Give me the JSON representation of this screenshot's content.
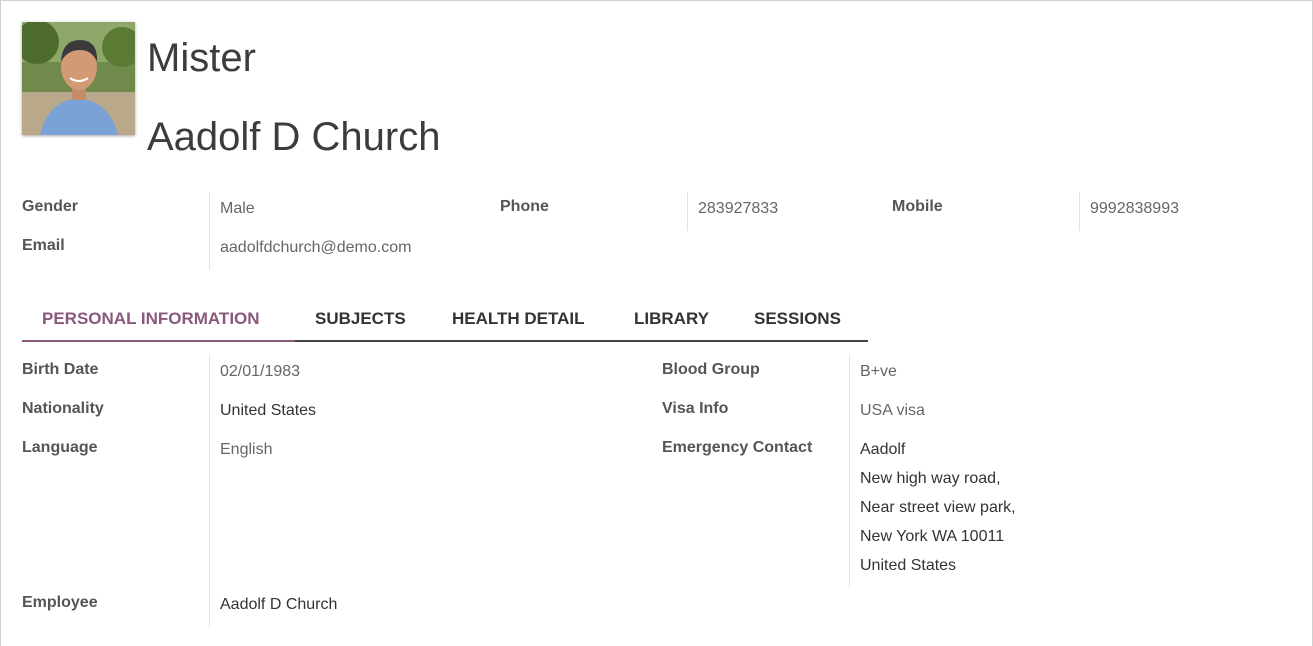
{
  "header": {
    "title": "Mister",
    "name": "Aadolf D Church"
  },
  "contact": {
    "gender_label": "Gender",
    "gender_value": "Male",
    "phone_label": "Phone",
    "phone_value": "283927833",
    "mobile_label": "Mobile",
    "mobile_value": "9992838993",
    "email_label": "Email",
    "email_value": "aadolfdchurch@demo.com"
  },
  "tabs": [
    {
      "label": "PERSONAL INFORMATION",
      "active": true
    },
    {
      "label": "SUBJECTS",
      "active": false
    },
    {
      "label": "HEALTH DETAIL",
      "active": false
    },
    {
      "label": "LIBRARY",
      "active": false
    },
    {
      "label": "SESSIONS",
      "active": false
    }
  ],
  "personal": {
    "birth_date_label": "Birth Date",
    "birth_date_value": "02/01/1983",
    "nationality_label": "Nationality",
    "nationality_value": "United States",
    "language_label": "Language",
    "language_value": "English",
    "employee_label": "Employee",
    "employee_value": "Aadolf D Church",
    "blood_group_label": "Blood Group",
    "blood_group_value": "B+ve",
    "visa_label": "Visa Info",
    "visa_value": "USA visa",
    "emergency_label": "Emergency Contact",
    "emergency_lines": [
      "Aadolf",
      "New high way road,",
      "Near street view park,",
      "New York WA 10011",
      "United States"
    ]
  },
  "colors": {
    "accent": "#875a7b",
    "text": "#4c4c4c"
  }
}
